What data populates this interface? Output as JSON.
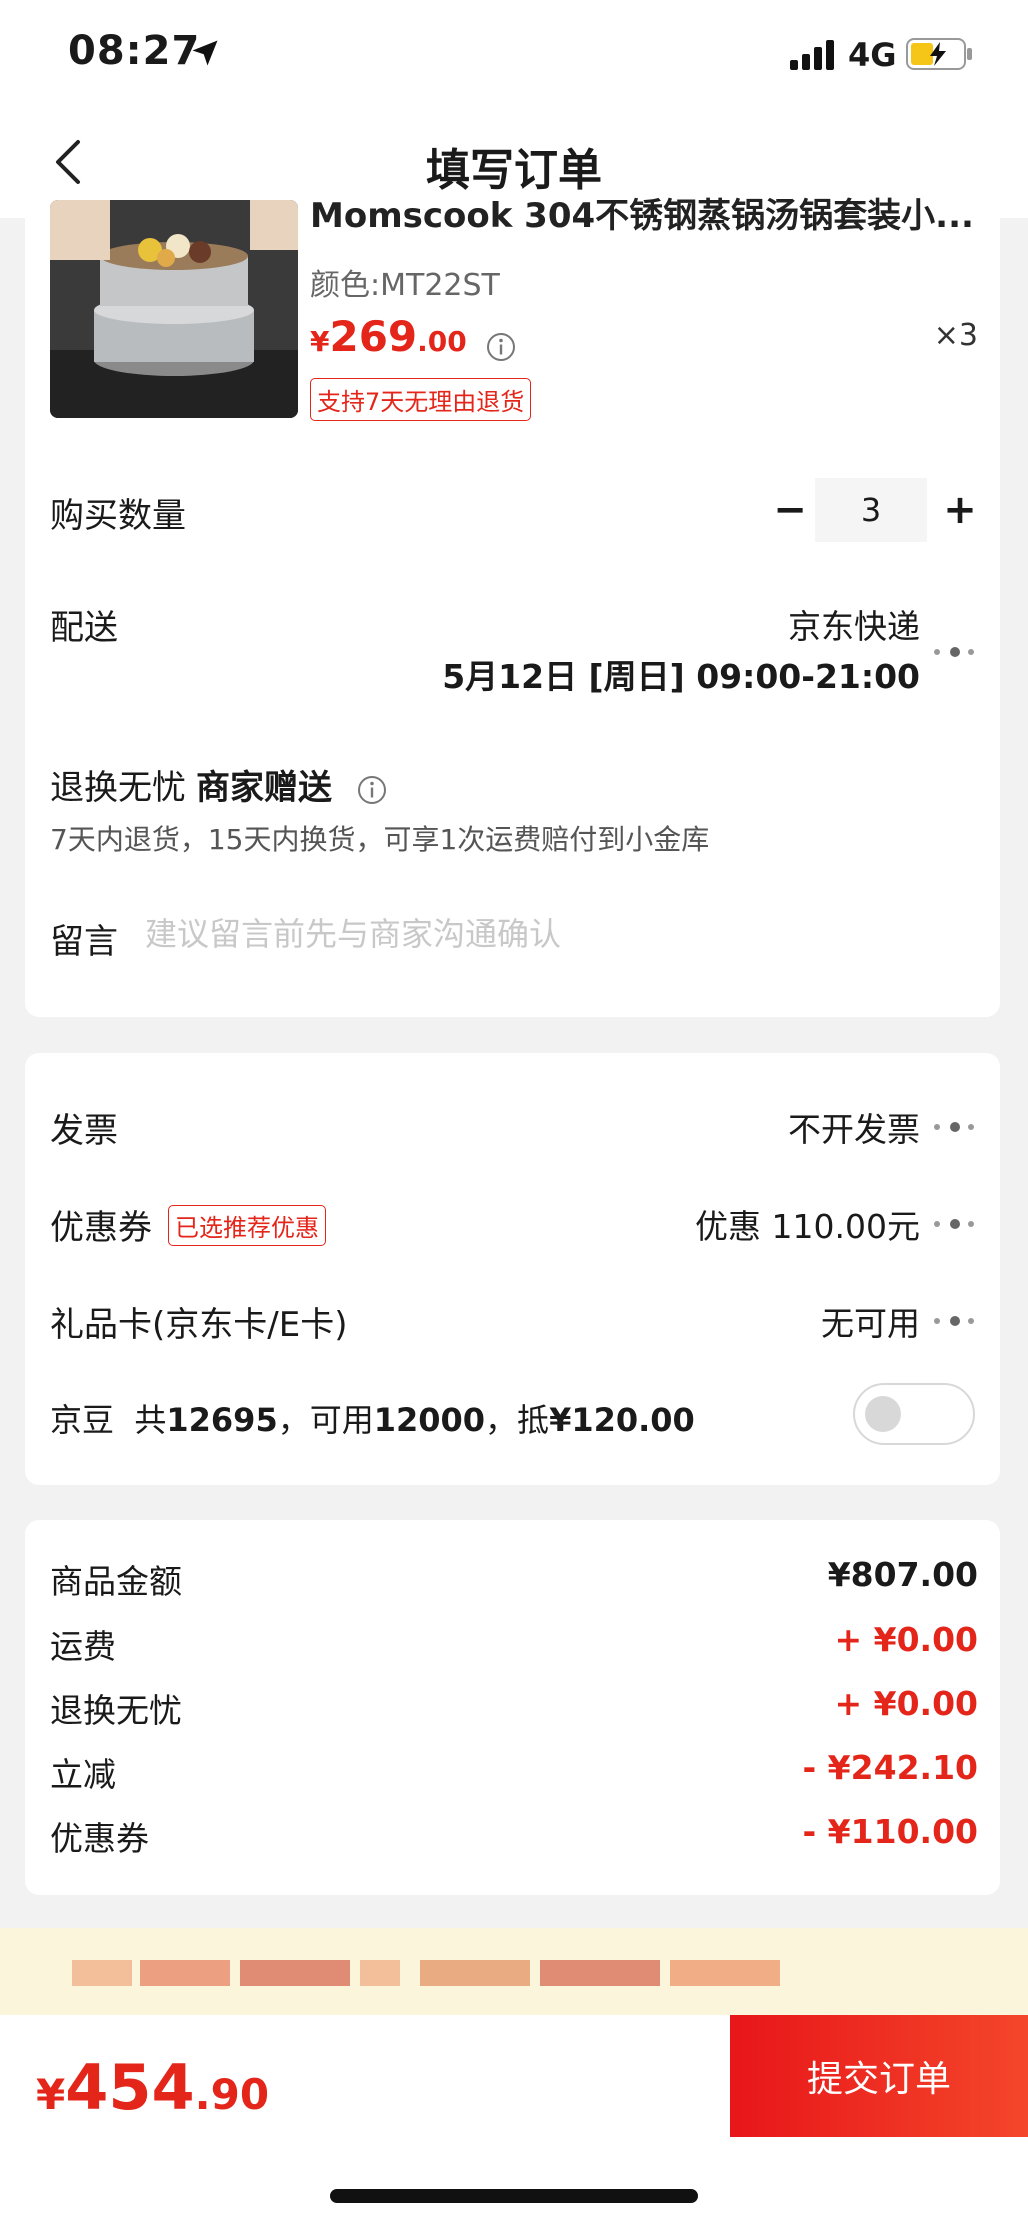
{
  "status_bar": {
    "time": "08:27",
    "network": "4G"
  },
  "nav": {
    "title": "填写订单"
  },
  "product": {
    "title": "Momscook 304不锈钢蒸锅汤锅套装小...",
    "color": "颜色:MT22ST",
    "price_symbol": "¥",
    "price_int": "269",
    "price_dec": ".00",
    "quantity_badge": "×3",
    "return_policy": "支持7天无理由退货"
  },
  "quantity": {
    "label": "购买数量",
    "value": "3",
    "minus": "−",
    "plus": "+"
  },
  "delivery": {
    "label": "配送",
    "carrier": "京东快递",
    "time": "5月12日 [周日] 09:00-21:00"
  },
  "return_service": {
    "title": "退换无忧",
    "gift": "商家赠送",
    "desc": "7天内退货，15天内换货，可享1次运费赔付到小金库"
  },
  "message": {
    "label": "留言",
    "placeholder": "建议留言前先与商家沟通确认"
  },
  "invoice": {
    "label": "发票",
    "value": "不开发票"
  },
  "coupon": {
    "label": "优惠券",
    "badge": "已选推荐优惠",
    "value": "优惠 110.00元"
  },
  "gift_card": {
    "label": "礼品卡(京东卡/E卡)",
    "value": "无可用"
  },
  "jd_beans": {
    "label": "京豆",
    "total_prefix": "共",
    "total": "12695",
    "usable_prefix": "，可用",
    "usable": "12000",
    "deduct_prefix": "，抵",
    "deduct": "¥120.00",
    "enabled": false
  },
  "summary": {
    "goods_label": "商品金额",
    "goods_value": "¥807.00",
    "shipping_label": "运费",
    "shipping_value": "+ ¥0.00",
    "worry_label": "退换无忧",
    "worry_value": "+ ¥0.00",
    "discount_label": "立减",
    "discount_value": "- ¥242.10",
    "coupon_label": "优惠券",
    "coupon_value": "- ¥110.00"
  },
  "footer": {
    "total_symbol": "¥",
    "total_int": "454",
    "total_dec": ".90",
    "submit_label": "提交订单"
  },
  "colors": {
    "accent": "#e4251a",
    "promo_bg": "#fbf5dc"
  }
}
